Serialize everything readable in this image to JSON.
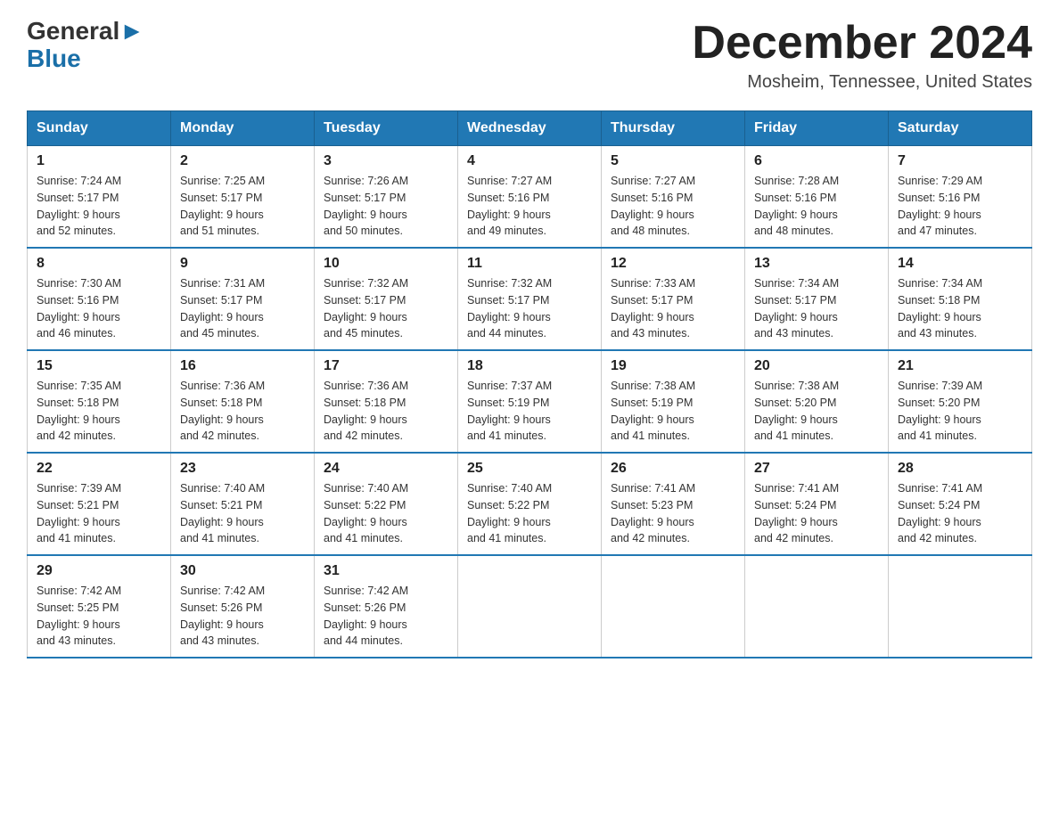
{
  "header": {
    "logo_general": "General",
    "logo_blue": "Blue",
    "month_title": "December 2024",
    "location": "Mosheim, Tennessee, United States"
  },
  "weekdays": [
    "Sunday",
    "Monday",
    "Tuesday",
    "Wednesday",
    "Thursday",
    "Friday",
    "Saturday"
  ],
  "weeks": [
    [
      {
        "day": "1",
        "sunrise": "7:24 AM",
        "sunset": "5:17 PM",
        "daylight": "9 hours and 52 minutes."
      },
      {
        "day": "2",
        "sunrise": "7:25 AM",
        "sunset": "5:17 PM",
        "daylight": "9 hours and 51 minutes."
      },
      {
        "day": "3",
        "sunrise": "7:26 AM",
        "sunset": "5:17 PM",
        "daylight": "9 hours and 50 minutes."
      },
      {
        "day": "4",
        "sunrise": "7:27 AM",
        "sunset": "5:16 PM",
        "daylight": "9 hours and 49 minutes."
      },
      {
        "day": "5",
        "sunrise": "7:27 AM",
        "sunset": "5:16 PM",
        "daylight": "9 hours and 48 minutes."
      },
      {
        "day": "6",
        "sunrise": "7:28 AM",
        "sunset": "5:16 PM",
        "daylight": "9 hours and 48 minutes."
      },
      {
        "day": "7",
        "sunrise": "7:29 AM",
        "sunset": "5:16 PM",
        "daylight": "9 hours and 47 minutes."
      }
    ],
    [
      {
        "day": "8",
        "sunrise": "7:30 AM",
        "sunset": "5:16 PM",
        "daylight": "9 hours and 46 minutes."
      },
      {
        "day": "9",
        "sunrise": "7:31 AM",
        "sunset": "5:17 PM",
        "daylight": "9 hours and 45 minutes."
      },
      {
        "day": "10",
        "sunrise": "7:32 AM",
        "sunset": "5:17 PM",
        "daylight": "9 hours and 45 minutes."
      },
      {
        "day": "11",
        "sunrise": "7:32 AM",
        "sunset": "5:17 PM",
        "daylight": "9 hours and 44 minutes."
      },
      {
        "day": "12",
        "sunrise": "7:33 AM",
        "sunset": "5:17 PM",
        "daylight": "9 hours and 43 minutes."
      },
      {
        "day": "13",
        "sunrise": "7:34 AM",
        "sunset": "5:17 PM",
        "daylight": "9 hours and 43 minutes."
      },
      {
        "day": "14",
        "sunrise": "7:34 AM",
        "sunset": "5:18 PM",
        "daylight": "9 hours and 43 minutes."
      }
    ],
    [
      {
        "day": "15",
        "sunrise": "7:35 AM",
        "sunset": "5:18 PM",
        "daylight": "9 hours and 42 minutes."
      },
      {
        "day": "16",
        "sunrise": "7:36 AM",
        "sunset": "5:18 PM",
        "daylight": "9 hours and 42 minutes."
      },
      {
        "day": "17",
        "sunrise": "7:36 AM",
        "sunset": "5:18 PM",
        "daylight": "9 hours and 42 minutes."
      },
      {
        "day": "18",
        "sunrise": "7:37 AM",
        "sunset": "5:19 PM",
        "daylight": "9 hours and 41 minutes."
      },
      {
        "day": "19",
        "sunrise": "7:38 AM",
        "sunset": "5:19 PM",
        "daylight": "9 hours and 41 minutes."
      },
      {
        "day": "20",
        "sunrise": "7:38 AM",
        "sunset": "5:20 PM",
        "daylight": "9 hours and 41 minutes."
      },
      {
        "day": "21",
        "sunrise": "7:39 AM",
        "sunset": "5:20 PM",
        "daylight": "9 hours and 41 minutes."
      }
    ],
    [
      {
        "day": "22",
        "sunrise": "7:39 AM",
        "sunset": "5:21 PM",
        "daylight": "9 hours and 41 minutes."
      },
      {
        "day": "23",
        "sunrise": "7:40 AM",
        "sunset": "5:21 PM",
        "daylight": "9 hours and 41 minutes."
      },
      {
        "day": "24",
        "sunrise": "7:40 AM",
        "sunset": "5:22 PM",
        "daylight": "9 hours and 41 minutes."
      },
      {
        "day": "25",
        "sunrise": "7:40 AM",
        "sunset": "5:22 PM",
        "daylight": "9 hours and 41 minutes."
      },
      {
        "day": "26",
        "sunrise": "7:41 AM",
        "sunset": "5:23 PM",
        "daylight": "9 hours and 42 minutes."
      },
      {
        "day": "27",
        "sunrise": "7:41 AM",
        "sunset": "5:24 PM",
        "daylight": "9 hours and 42 minutes."
      },
      {
        "day": "28",
        "sunrise": "7:41 AM",
        "sunset": "5:24 PM",
        "daylight": "9 hours and 42 minutes."
      }
    ],
    [
      {
        "day": "29",
        "sunrise": "7:42 AM",
        "sunset": "5:25 PM",
        "daylight": "9 hours and 43 minutes."
      },
      {
        "day": "30",
        "sunrise": "7:42 AM",
        "sunset": "5:26 PM",
        "daylight": "9 hours and 43 minutes."
      },
      {
        "day": "31",
        "sunrise": "7:42 AM",
        "sunset": "5:26 PM",
        "daylight": "9 hours and 44 minutes."
      },
      null,
      null,
      null,
      null
    ]
  ]
}
